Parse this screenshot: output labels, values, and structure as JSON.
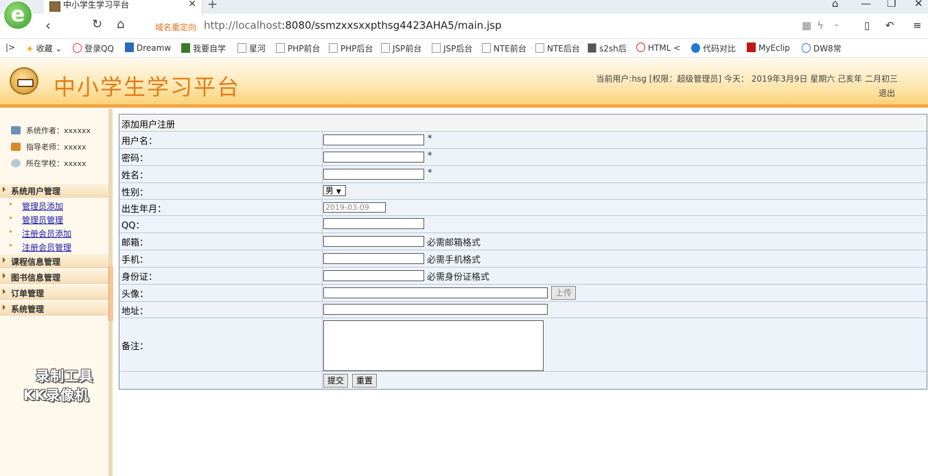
{
  "browser": {
    "tab_title": "中小学生学习平台",
    "new_tab": "+",
    "redirect_label": "域名重定向",
    "url_host": "http://localhost",
    "url_rest": ":8080/ssmzxxsxxpthsg4423AHA5/main.jsp",
    "bookmarks": [
      "收藏",
      "登录QQ",
      "Dreamw",
      "我要自学",
      "星河",
      "PHP前台",
      "PHP后台",
      "JSP前台",
      "JSP后台",
      "NTE前台",
      "NTE后台",
      "s2sh后",
      "HTML <",
      "代码对比",
      "MyEclip",
      "DW8常"
    ]
  },
  "header": {
    "title": "中小学生学习平台",
    "user_info": "当前用户:hsg [权限：超级管理员] 今天： 2019年3月9日 星期六 己亥年 二月初三",
    "logout": "退出"
  },
  "sidebar": {
    "info": [
      "系统作者：xxxxxx",
      "指导老师：xxxxx",
      "所在学校：xxxxx"
    ],
    "groups": [
      "系统用户管理",
      "课程信息管理",
      "图书信息管理",
      "订单管理",
      "系统管理"
    ],
    "links": [
      "管理员添加",
      "管理员管理",
      "注册会员添加",
      "注册会员管理"
    ],
    "watermark": [
      "录制工具",
      "KK录像机"
    ]
  },
  "form": {
    "heading": "添加用户注册",
    "labels": [
      "用户名：",
      "密码：",
      "姓名：",
      "性别：",
      "出生年月：",
      "QQ：",
      "邮箱：",
      "手机：",
      "身份证：",
      "头像：",
      "地址：",
      "备注："
    ],
    "required_mark": "*",
    "gender_value": "男",
    "birth_value": "2019-03-09",
    "email_note": "必需邮箱格式",
    "phone_note": "必需手机格式",
    "id_note": "必需身份证格式",
    "upload_btn": "上传",
    "submit_btn": "提交",
    "reset_btn": "重置"
  }
}
